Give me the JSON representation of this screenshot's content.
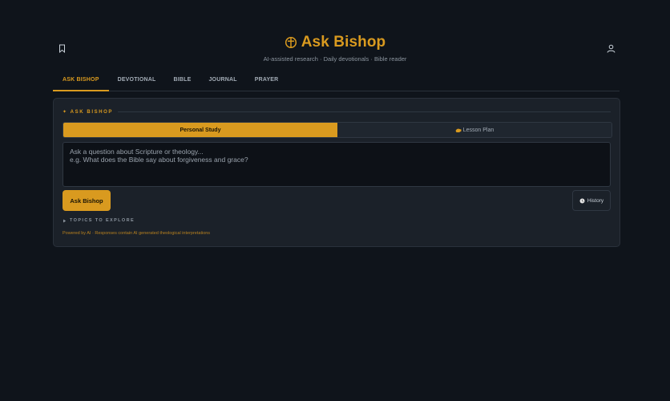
{
  "header": {
    "brand_title": "Ask Bishop",
    "subtitle": "AI-assisted research · Daily devotionals · Bible reader",
    "left_icon": "bookmark-icon",
    "right_icon": "user-icon",
    "brand_icon": "cross-circle-icon"
  },
  "tabs": [
    {
      "label": "ASK BISHOP",
      "active": true
    },
    {
      "label": "DEVOTIONAL",
      "active": false
    },
    {
      "label": "BIBLE",
      "active": false
    },
    {
      "label": "JOURNAL",
      "active": false
    },
    {
      "label": "PRAYER",
      "active": false
    }
  ],
  "panel": {
    "section_title": "✦ ASK BISHOP",
    "modes": {
      "personal_study": "Personal Study",
      "lesson_plan": "Lesson Plan",
      "lesson_plan_icon": "hand-icon"
    },
    "question_placeholder": "Ask a question about Scripture or theology...\ne.g. What does the Bible say about forgiveness and grace?",
    "question_value": "",
    "ask_button": "Ask Bishop",
    "history_button": "History",
    "history_icon": "clock-icon",
    "topics_label": "TOPICS TO EXPLORE",
    "footer_note": "Powered by AI · Responses contain AI generated theological interpretations"
  },
  "colors": {
    "background": "#0f141b",
    "accent": "#d99a1f",
    "panel": "#1b2129"
  }
}
